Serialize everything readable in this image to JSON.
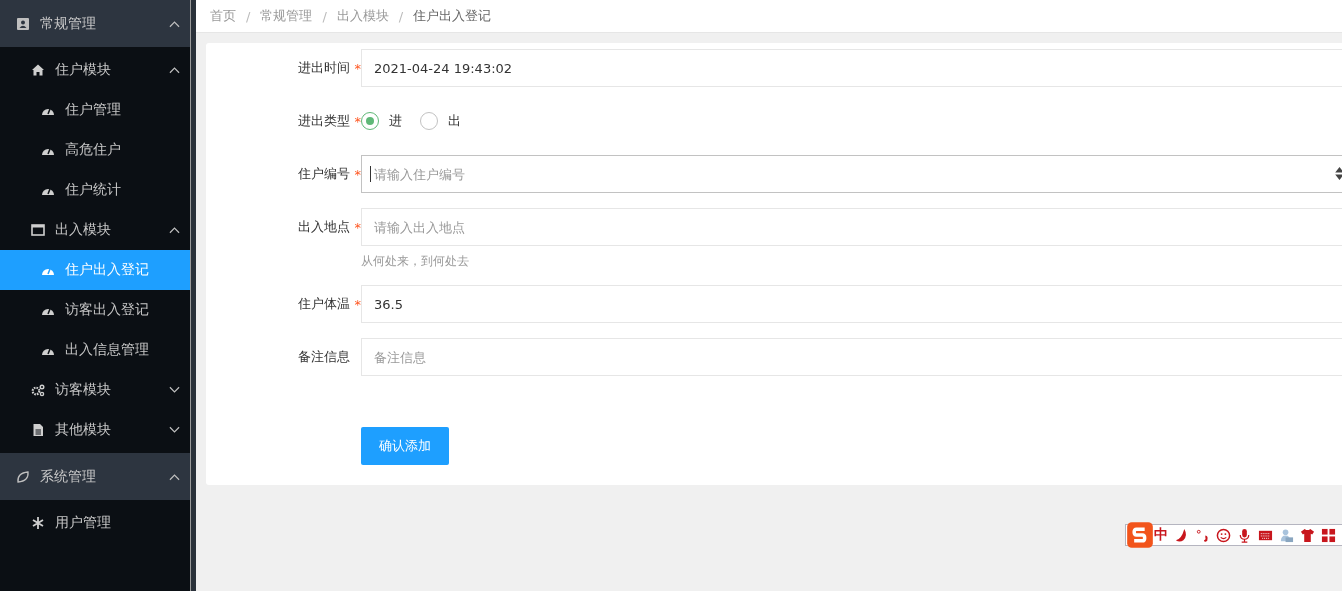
{
  "sidebar": {
    "groups": [
      {
        "label": "常规管理",
        "expanded": true,
        "children": [
          {
            "label": "住户模块",
            "expanded": true,
            "children": [
              {
                "label": "住户管理",
                "selected": false
              },
              {
                "label": "高危住户",
                "selected": false
              },
              {
                "label": "住户统计",
                "selected": false
              }
            ]
          },
          {
            "label": "出入模块",
            "expanded": true,
            "children": [
              {
                "label": "住户出入登记",
                "selected": true
              },
              {
                "label": "访客出入登记",
                "selected": false
              },
              {
                "label": "出入信息管理",
                "selected": false
              }
            ]
          },
          {
            "label": "访客模块",
            "expanded": false
          },
          {
            "label": "其他模块",
            "expanded": false
          }
        ]
      },
      {
        "label": "系统管理",
        "expanded": true,
        "children": [
          {
            "label": "用户管理",
            "selected": false
          }
        ]
      }
    ]
  },
  "breadcrumb": {
    "separator": "/",
    "items": [
      "首页",
      "常规管理",
      "出入模块",
      "住户出入登记"
    ]
  },
  "form": {
    "required_mark": "*",
    "fields": [
      {
        "kind": "input",
        "label": "进出时间",
        "required": true,
        "value": "2021-04-24 19:43:02"
      },
      {
        "kind": "radio",
        "label": "进出类型",
        "required": true,
        "options": [
          {
            "label": "进",
            "selected": true
          },
          {
            "label": "出",
            "selected": false
          }
        ]
      },
      {
        "kind": "number",
        "label": "住户编号",
        "required": true,
        "placeholder": "请输入住户编号",
        "focused": true
      },
      {
        "kind": "input",
        "label": "出入地点",
        "required": true,
        "placeholder": "请输入出入地点",
        "hint": "从何处来，到何处去"
      },
      {
        "kind": "input",
        "label": "住户体温",
        "required": true,
        "value": "36.5"
      },
      {
        "kind": "input",
        "label": "备注信息",
        "required": false,
        "placeholder": "备注信息"
      }
    ],
    "submit": "确认添加"
  },
  "ime_toolbar": {
    "mode": "中"
  }
}
